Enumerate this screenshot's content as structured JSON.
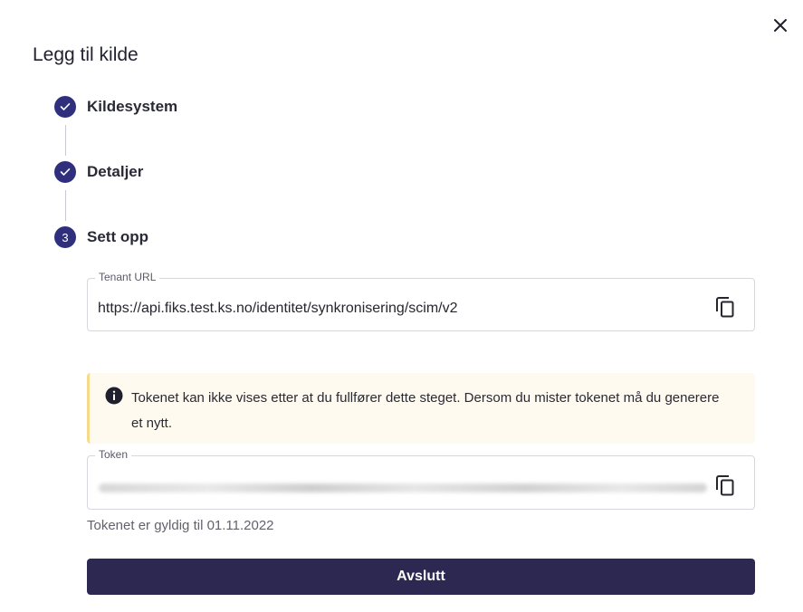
{
  "dialog": {
    "title": "Legg til kilde",
    "close_icon": "close-icon"
  },
  "steps": [
    {
      "label": "Kildesystem",
      "status": "completed",
      "icon": "check-icon"
    },
    {
      "label": "Detaljer",
      "status": "completed",
      "icon": "check-icon"
    },
    {
      "label": "Sett opp",
      "status": "active",
      "number": "3"
    }
  ],
  "tenant_url": {
    "label": "Tenant URL",
    "value": "https://api.fiks.test.ks.no/identitet/synkronisering/scim/v2",
    "copy_icon": "copy-icon"
  },
  "alert": {
    "icon": "info-icon",
    "text": "Tokenet kan ikke vises etter at du fullfører dette steget. Dersom du mister tokenet må du generere et nytt."
  },
  "token": {
    "label": "Token",
    "copy_icon": "copy-icon"
  },
  "validity_text": "Tokenet er gyldig til 01.11.2022",
  "finish_button": "Avslutt",
  "colors": {
    "step_circle": "#2f2f7e",
    "primary_button": "#2c2852",
    "alert_background": "#fffaf0",
    "alert_border": "#f6d98a"
  }
}
